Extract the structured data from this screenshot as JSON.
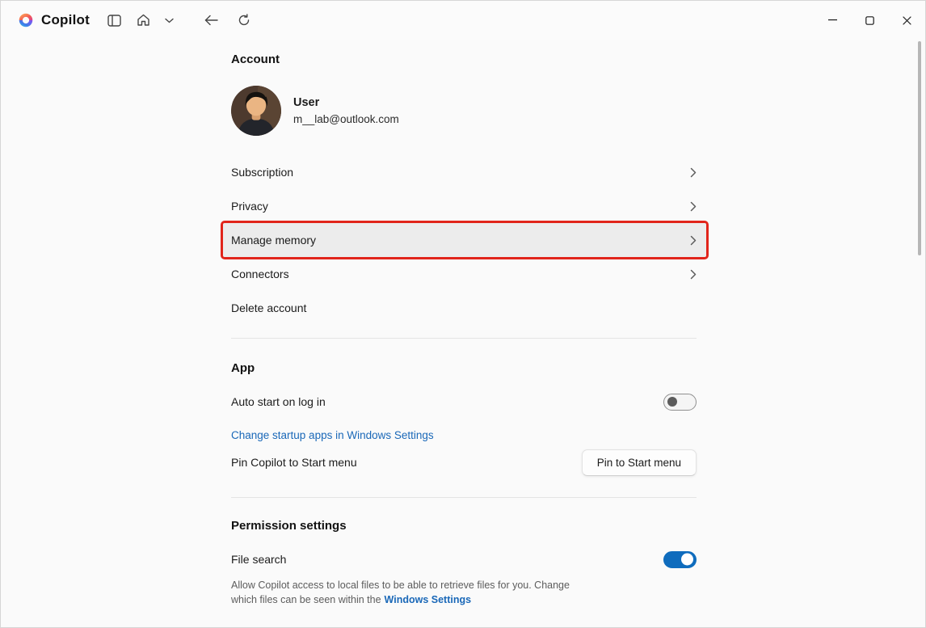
{
  "titlebar": {
    "app_name": "Copilot"
  },
  "account": {
    "heading": "Account",
    "user_name": "User",
    "user_email": "m__lab@outlook.com",
    "items": [
      {
        "label": "Subscription"
      },
      {
        "label": "Privacy"
      },
      {
        "label": "Manage memory"
      },
      {
        "label": "Connectors"
      },
      {
        "label": "Delete account"
      }
    ]
  },
  "app_section": {
    "heading": "App",
    "auto_start_label": "Auto start on log in",
    "auto_start_enabled": false,
    "startup_link_label": "Change startup apps in Windows Settings",
    "pin_label": "Pin Copilot to Start menu",
    "pin_button_label": "Pin to Start menu"
  },
  "permissions": {
    "heading": "Permission settings",
    "file_search_label": "File search",
    "file_search_enabled": true,
    "file_search_description": "Allow Copilot access to local files to be able to retrieve files for you. Change which files can be seen within the",
    "file_search_link_label": "Windows Settings"
  },
  "colors": {
    "accent_blue": "#1a68b8",
    "toggle_on_blue": "#0f6cbd",
    "highlight_red": "#e1251b"
  }
}
